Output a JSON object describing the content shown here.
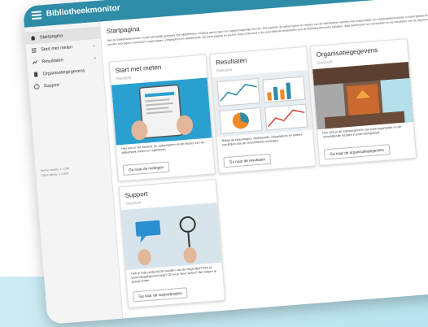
{
  "app": {
    "title": "Bibliotheekmonitor"
  },
  "sidebar": {
    "items": [
      {
        "label": "Startpagina",
        "icon": "home-icon"
      },
      {
        "label": "Start met meten",
        "icon": "list-icon"
      },
      {
        "label": "Resultaten",
        "icon": "chart-icon"
      },
      {
        "label": "Organisatiegegevens",
        "icon": "building-icon"
      },
      {
        "label": "Support",
        "icon": "help-icon"
      }
    ],
    "version_1": "Server versie: 1.1.159",
    "version_2": "Client versie: 1.1.838"
  },
  "main": {
    "title": "Startpagina",
    "intro": "Met de Bibliotheekmonitor wordt inzichtelijk gemaakt hoe bibliotheken invulling geven aan hun maatschappelijke functie. Het aanbod, de opbrengsten en impact van de bibliotheken worden met vragenlijsten en registratieformulieren in kaart gebracht. De resultaten worden vervolgens verwerkt in rapportages, infographics en dashboards. Op deze pagina en via het menu links kunt u de verschillende onderdelen van de Bibliotheekmonitor bekijken, data aanleveren en verzamelen en de resultaten van de afgeronde metingen inzien."
  },
  "cards": [
    {
      "title": "Start met meten",
      "subtitle": "Overzicht",
      "text": "Hier kun je het aanbod, de opbrengsten en de impact van de bibliotheek meten en registreren.",
      "button": "Ga naar de metingen"
    },
    {
      "title": "Resultaten",
      "subtitle": "Overzicht",
      "text": "Bekijk de rapportages, dashboards, infographics en andere resultaten van de verschillende metingen.",
      "button": "Ga naar de resultaten"
    },
    {
      "title": "Organisatiegegevens",
      "subtitle": "Overzicht",
      "text": "Hier vind je de basisgegevens van jouw organisatie en de verschillende locaties in jouw werkgebied.",
      "button": "Ga naar de organisatiegegevens"
    },
    {
      "title": "Support",
      "subtitle": "Overzicht",
      "text": "Heb je hulp nodig bij het invullen van de vragenlijst? Ben je jouw inloggegevens kwijt? Of wil je meer weten? We helpen je graag verder.",
      "button": "Ga naar de supportpagina"
    }
  ],
  "colors": {
    "topbar": "#2e8ca7",
    "background_accent": "#b9e4ef"
  }
}
